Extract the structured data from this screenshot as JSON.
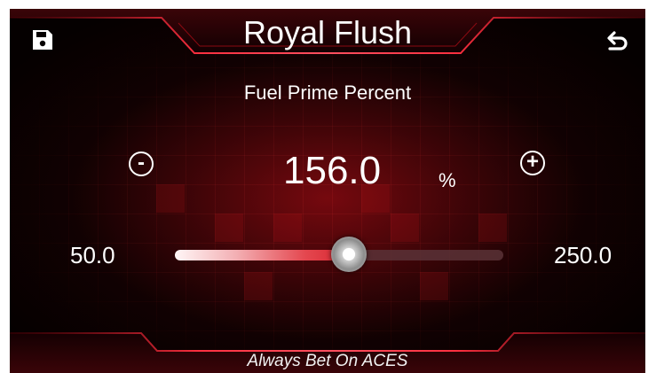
{
  "header": {
    "title": "Royal Flush"
  },
  "toolbar": {
    "save_icon": "save-icon",
    "back_icon": "undo-back-icon"
  },
  "parameter": {
    "label": "Fuel Prime Percent",
    "value": "156.0",
    "unit": "%",
    "min_label": "50.0",
    "max_label": "250.0",
    "value_num": 156.0,
    "min_num": 50.0,
    "max_num": 250.0,
    "decrement_label": "-",
    "increment_label": "+"
  },
  "footer": {
    "text": "Always Bet On ACES"
  },
  "colors": {
    "accent": "#d8262f",
    "background": "#050000",
    "text": "#ffffff"
  }
}
